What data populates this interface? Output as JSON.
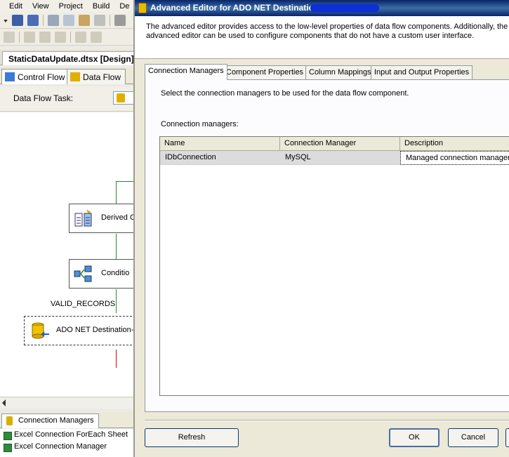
{
  "ide": {
    "menu": [
      "Edit",
      "View",
      "Project",
      "Build",
      "De"
    ],
    "document_tab": "StaticDataUpdate.dtsx [Design]",
    "design_tabs": {
      "control_flow": "Control Flow",
      "data_flow": "Data Flow"
    },
    "data_flow_task_label": "Data Flow Task:",
    "components": {
      "derived": "Derived C",
      "conditional": "Conditio",
      "destination": "ADO NET Destination-I"
    },
    "path_label": "VALID_RECORDS",
    "connection_managers_tab": "Connection Managers",
    "connection_items": [
      "Excel Connection ForEach Sheet",
      "Excel Connection Manager"
    ]
  },
  "dialog": {
    "title": "Advanced Editor for ADO NET Destination-",
    "description": "The advanced editor provides access to the low-level properties of data flow components. Additionally, the advanced editor can be used to configure components that do not have a custom user interface.",
    "tabs": [
      "Connection Managers",
      "Component Properties",
      "Column Mappings",
      "Input and Output Properties"
    ],
    "active_tab": 0,
    "instruction": "Select the connection managers to be used for the data flow component.",
    "connection_managers_label": "Connection managers:",
    "grid": {
      "columns": [
        "Name",
        "Connection Manager",
        "Description"
      ],
      "rows": [
        {
          "name": "IDbConnection",
          "connection_manager": "MySQL",
          "description": "Managed connection manager"
        }
      ]
    },
    "buttons": {
      "refresh": "Refresh",
      "ok": "OK",
      "cancel": "Cancel"
    }
  }
}
